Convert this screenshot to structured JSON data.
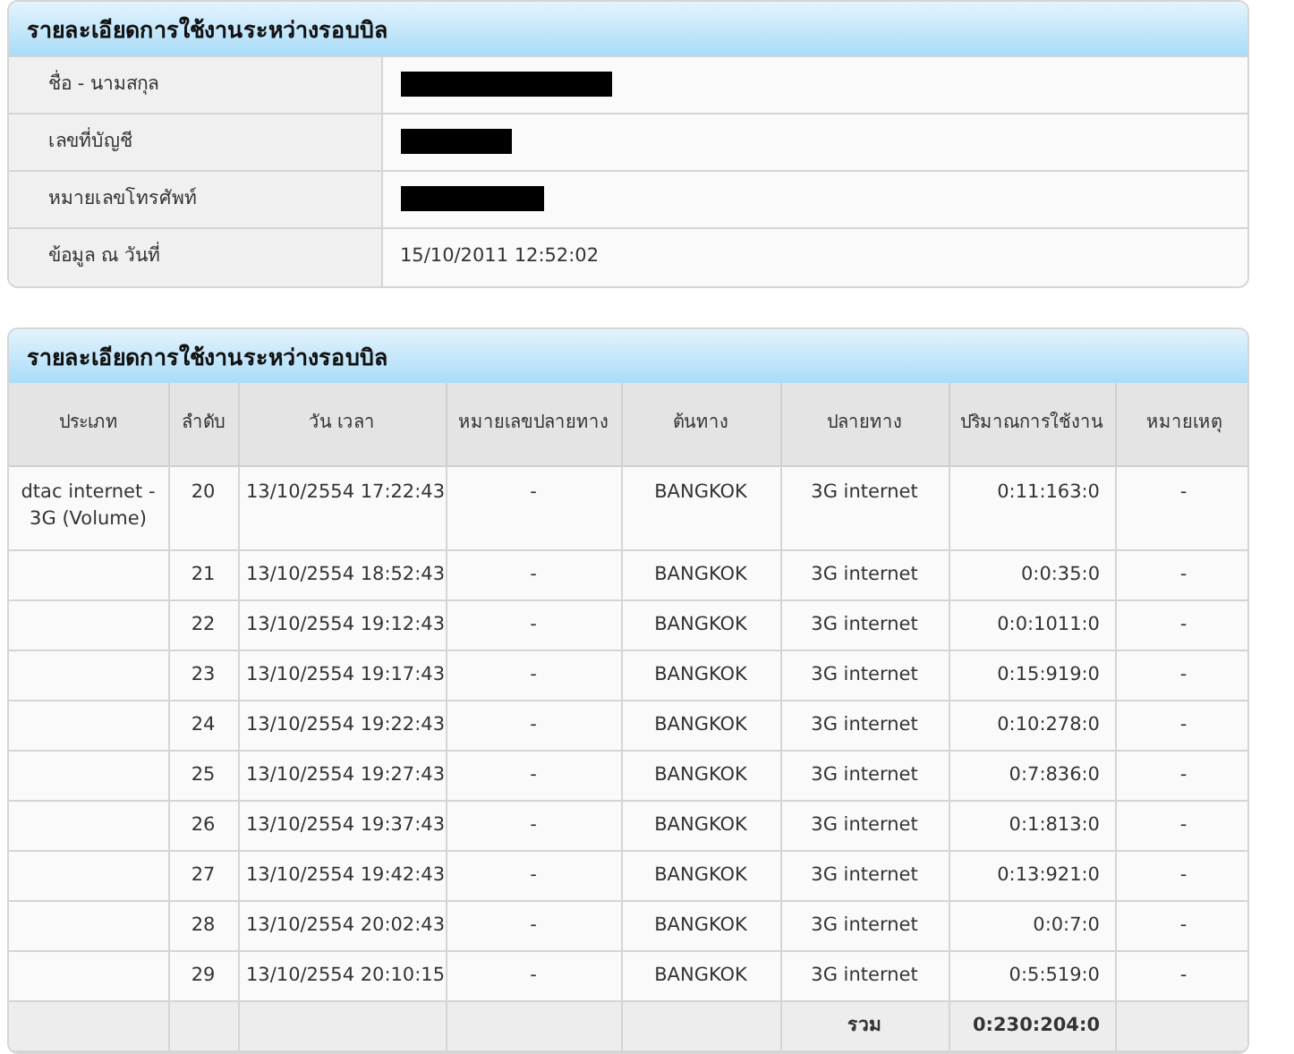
{
  "account_panel": {
    "title": "รายละเอียดการใช้งานระหว่างรอบบิล",
    "rows": [
      {
        "label": "ชื่อ - นามสกุล",
        "redacted": true
      },
      {
        "label": "เลขที่บัญชี",
        "redacted": true
      },
      {
        "label": "หมายเลขโทรศัพท์",
        "redacted": true
      },
      {
        "label": "ข้อมูล ณ วันที่",
        "redacted": false,
        "value": "15/10/2011 12:52:02"
      }
    ]
  },
  "usage_panel": {
    "title": "รายละเอียดการใช้งานระหว่างรอบบิล",
    "table": {
      "columns": [
        "ประเภท",
        "ลำดับ",
        "วัน เวลา",
        "หมายเลขปลายทาง",
        "ต้นทาง",
        "ปลายทาง",
        "ปริมาณการใช้งาน",
        "หมายเหตุ"
      ],
      "rows": [
        [
          "dtac internet - 3G (Volume)",
          "20",
          "13/10/2554 17:22:43",
          "-",
          "BANGKOK",
          "3G internet",
          "0:11:163:0",
          "-"
        ],
        [
          "",
          "21",
          "13/10/2554 18:52:43",
          "-",
          "BANGKOK",
          "3G internet",
          "0:0:35:0",
          "-"
        ],
        [
          "",
          "22",
          "13/10/2554 19:12:43",
          "-",
          "BANGKOK",
          "3G internet",
          "0:0:1011:0",
          "-"
        ],
        [
          "",
          "23",
          "13/10/2554 19:17:43",
          "-",
          "BANGKOK",
          "3G internet",
          "0:15:919:0",
          "-"
        ],
        [
          "",
          "24",
          "13/10/2554 19:22:43",
          "-",
          "BANGKOK",
          "3G internet",
          "0:10:278:0",
          "-"
        ],
        [
          "",
          "25",
          "13/10/2554 19:27:43",
          "-",
          "BANGKOK",
          "3G internet",
          "0:7:836:0",
          "-"
        ],
        [
          "",
          "26",
          "13/10/2554 19:37:43",
          "-",
          "BANGKOK",
          "3G internet",
          "0:1:813:0",
          "-"
        ],
        [
          "",
          "27",
          "13/10/2554 19:42:43",
          "-",
          "BANGKOK",
          "3G internet",
          "0:13:921:0",
          "-"
        ],
        [
          "",
          "28",
          "13/10/2554 20:02:43",
          "-",
          "BANGKOK",
          "3G internet",
          "0:0:7:0",
          "-"
        ],
        [
          "",
          "29",
          "13/10/2554 20:10:15",
          "-",
          "BANGKOK",
          "3G internet",
          "0:5:519:0",
          "-"
        ]
      ],
      "total": {
        "label": "รวม",
        "value": "0:230:204:0"
      }
    }
  }
}
